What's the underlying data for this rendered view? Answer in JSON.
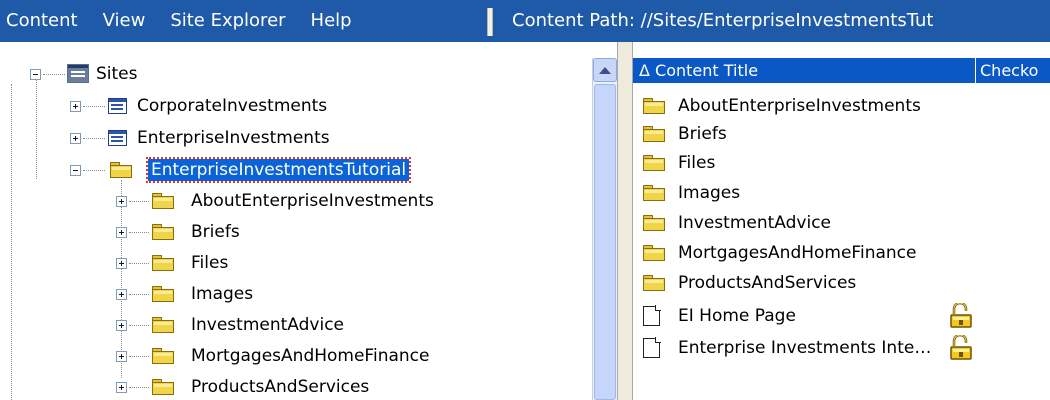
{
  "menu": {
    "items": [
      "Content",
      "View",
      "Site Explorer",
      "Help"
    ]
  },
  "content_path": "Content Path:  //Sites/EnterpriseInvestmentsTut",
  "tree": {
    "root": {
      "label": "Sites",
      "icon": "site-icon"
    },
    "sites": [
      {
        "label": "CorporateInvestments",
        "icon": "site-icon"
      },
      {
        "label": "EnterpriseInvestments",
        "icon": "site-icon"
      },
      {
        "label": "EnterpriseInvestmentsTutorial",
        "icon": "folder-icon",
        "selected": true
      }
    ],
    "children": [
      "AboutEnterpriseInvestments",
      "Briefs",
      "Files",
      "Images",
      "InvestmentAdvice",
      "MortgagesAndHomeFinance",
      "ProductsAndServices"
    ]
  },
  "list": {
    "headers": {
      "title": "Δ Content Title",
      "checkout": "Checko"
    },
    "rows": [
      {
        "label": "AboutEnterpriseInvestments",
        "icon": "folder-icon",
        "locked": false
      },
      {
        "label": "Briefs",
        "icon": "folder-icon",
        "locked": false
      },
      {
        "label": "Files",
        "icon": "folder-icon",
        "locked": false
      },
      {
        "label": "Images",
        "icon": "folder-icon",
        "locked": false
      },
      {
        "label": "InvestmentAdvice",
        "icon": "folder-icon",
        "locked": false
      },
      {
        "label": "MortgagesAndHomeFinance",
        "icon": "folder-icon",
        "locked": false
      },
      {
        "label": "ProductsAndServices",
        "icon": "folder-icon",
        "locked": false
      },
      {
        "label": "EI Home Page",
        "icon": "page-icon",
        "locked": true
      },
      {
        "label": "Enterprise Investments Inte…",
        "icon": "page-icon",
        "locked": true
      }
    ]
  },
  "colors": {
    "menubar": "#1e5aa7",
    "selection": "#0a64d7",
    "header": "#0a58c6",
    "folder": "#f0d548"
  }
}
